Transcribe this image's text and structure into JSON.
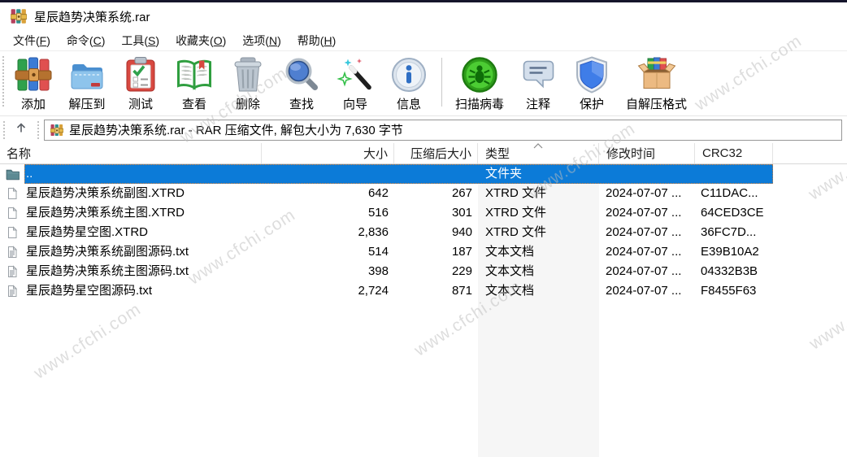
{
  "window": {
    "title": "星辰趋势决策系统.rar"
  },
  "menu_bar": {
    "items": [
      {
        "id": "file",
        "pre": "文件(",
        "key": "F",
        "post": ")"
      },
      {
        "id": "commands",
        "pre": "命令(",
        "key": "C",
        "post": ")"
      },
      {
        "id": "tools",
        "pre": "工具(",
        "key": "S",
        "post": ")"
      },
      {
        "id": "favorites",
        "pre": "收藏夹(",
        "key": "O",
        "post": ")"
      },
      {
        "id": "options",
        "pre": "选项(",
        "key": "N",
        "post": ")"
      },
      {
        "id": "help",
        "pre": "帮助(",
        "key": "H",
        "post": ")"
      }
    ]
  },
  "toolbar": {
    "buttons": [
      {
        "id": "add",
        "label": "添加",
        "icon": "add-books-icon"
      },
      {
        "id": "extract-to",
        "label": "解压到",
        "icon": "extract-folder-icon"
      },
      {
        "id": "test",
        "label": "测试",
        "icon": "test-clipboard-icon"
      },
      {
        "id": "view",
        "label": "查看",
        "icon": "view-book-icon"
      },
      {
        "id": "delete",
        "label": "删除",
        "icon": "delete-trash-icon"
      },
      {
        "id": "find",
        "label": "查找",
        "icon": "find-magnifier-icon"
      },
      {
        "id": "wizard",
        "label": "向导",
        "icon": "wizard-wand-icon"
      },
      {
        "id": "info",
        "label": "信息",
        "icon": "info-icon"
      },
      {
        "separator": true
      },
      {
        "id": "scan-virus",
        "label": "扫描病毒",
        "icon": "virus-scan-icon"
      },
      {
        "id": "comment",
        "label": "注释",
        "icon": "comment-bubble-icon"
      },
      {
        "id": "protect",
        "label": "保护",
        "icon": "shield-icon"
      },
      {
        "id": "sfx",
        "label": "自解压格式",
        "icon": "sfx-box-icon"
      }
    ]
  },
  "address_bar": {
    "up_icon": "up-arrow-icon",
    "archive_icon": "winrar-icon",
    "text": "星辰趋势决策系统.rar - RAR 压缩文件, 解包大小为 7,630 字节"
  },
  "file_list": {
    "columns": [
      {
        "id": "name",
        "label": "名称"
      },
      {
        "id": "size",
        "label": "大小"
      },
      {
        "id": "packed",
        "label": "压缩后大小"
      },
      {
        "id": "type",
        "label": "类型"
      },
      {
        "id": "modified",
        "label": "修改时间"
      },
      {
        "id": "crc",
        "label": "CRC32"
      }
    ],
    "sorted_column": "type",
    "sort_ascending": true,
    "rows": [
      {
        "name": "..",
        "icon": "folder-up-icon",
        "size": "",
        "packed": "",
        "type": "文件夹",
        "modified": "",
        "crc": "",
        "selected": true
      },
      {
        "name": "星辰趋势决策系统副图.XTRD",
        "icon": "file-icon",
        "size": "642",
        "packed": "267",
        "type": "XTRD 文件",
        "modified": "2024-07-07 ...",
        "crc": "C11DAC...",
        "selected": false
      },
      {
        "name": "星辰趋势决策系统主图.XTRD",
        "icon": "file-icon",
        "size": "516",
        "packed": "301",
        "type": "XTRD 文件",
        "modified": "2024-07-07 ...",
        "crc": "64CED3CE",
        "selected": false
      },
      {
        "name": "星辰趋势星空图.XTRD",
        "icon": "file-icon",
        "size": "2,836",
        "packed": "940",
        "type": "XTRD 文件",
        "modified": "2024-07-07 ...",
        "crc": "36FC7D...",
        "selected": false
      },
      {
        "name": "星辰趋势决策系统副图源码.txt",
        "icon": "text-file-icon",
        "size": "514",
        "packed": "187",
        "type": "文本文档",
        "modified": "2024-07-07 ...",
        "crc": "E39B10A2",
        "selected": false
      },
      {
        "name": "星辰趋势决策系统主图源码.txt",
        "icon": "text-file-icon",
        "size": "398",
        "packed": "229",
        "type": "文本文档",
        "modified": "2024-07-07 ...",
        "crc": "04332B3B",
        "selected": false
      },
      {
        "name": "星辰趋势星空图源码.txt",
        "icon": "text-file-icon",
        "size": "2,724",
        "packed": "871",
        "type": "文本文档",
        "modified": "2024-07-07 ...",
        "crc": "F8455F63",
        "selected": false
      }
    ]
  },
  "watermark": {
    "text": "www.cfchi.com"
  },
  "colors": {
    "selection_blue": "#0c7bd8",
    "selection_focus_dotted": "#d27c35",
    "sorted_column_bg": "#f6f6f6",
    "watermark_gray": "#bdbdbd",
    "top_border": "#15152b"
  }
}
